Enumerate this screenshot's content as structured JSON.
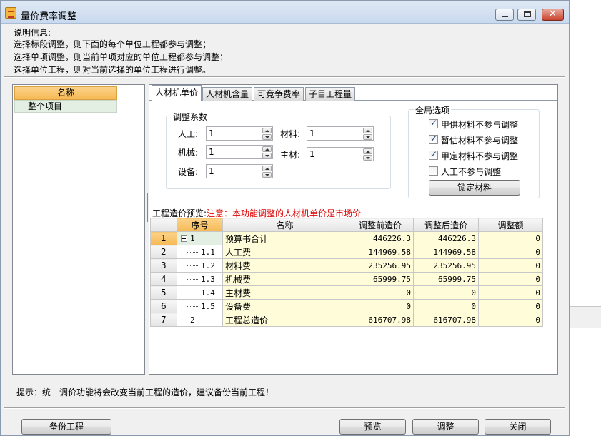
{
  "window": {
    "title": "量价费率调整"
  },
  "description": {
    "title": "说明信息:",
    "lines": [
      "选择标段调整，则下面的每个单位工程都参与调整；",
      "选择单项调整，则当前单项对应的单位工程都参与调整；",
      "选择单位工程，则对当前选择的单位工程进行调整。"
    ]
  },
  "left_tree": {
    "header": "名称",
    "items": [
      "整个项目"
    ]
  },
  "tabs": [
    "人材机单价",
    "人材机含量",
    "可竞争费率",
    "子目工程量"
  ],
  "coefficients": {
    "title": "调整系数",
    "labor_label": "人工:",
    "labor_value": "1",
    "material_label": "材料:",
    "material_value": "1",
    "machine_label": "机械:",
    "machine_value": "1",
    "main_material_label": "主材:",
    "main_material_value": "1",
    "equipment_label": "设备:",
    "equipment_value": "1"
  },
  "global_options": {
    "title": "全局选项",
    "options": [
      {
        "label": "甲供材料不参与调整",
        "checked": true
      },
      {
        "label": "暂估材料不参与调整",
        "checked": true
      },
      {
        "label": "甲定材料不参与调整",
        "checked": true
      },
      {
        "label": "人工不参与调整",
        "checked": false
      }
    ],
    "lock_button": "锁定材料"
  },
  "preview": {
    "label": "工程造价预览:",
    "warning": "注意：本功能调整的人材机单价是市场价"
  },
  "table": {
    "headers": [
      "序号",
      "名称",
      "调整前造价",
      "调整后造价",
      "调整额"
    ],
    "rows": [
      {
        "row": "1",
        "seq": "1",
        "name": "预算书合计",
        "before": "446226.3",
        "after": "446226.3",
        "diff": "0"
      },
      {
        "row": "2",
        "seq": "1.1",
        "name": "人工费",
        "before": "144969.58",
        "after": "144969.58",
        "diff": "0"
      },
      {
        "row": "3",
        "seq": "1.2",
        "name": "材料费",
        "before": "235256.95",
        "after": "235256.95",
        "diff": "0"
      },
      {
        "row": "4",
        "seq": "1.3",
        "name": "机械费",
        "before": "65999.75",
        "after": "65999.75",
        "diff": "0"
      },
      {
        "row": "5",
        "seq": "1.4",
        "name": "主材费",
        "before": "0",
        "after": "0",
        "diff": "0"
      },
      {
        "row": "6",
        "seq": "1.5",
        "name": "设备费",
        "before": "0",
        "after": "0",
        "diff": "0"
      },
      {
        "row": "7",
        "seq": "2",
        "name": "工程总造价",
        "before": "616707.98",
        "after": "616707.98",
        "diff": "0"
      }
    ]
  },
  "hint": "提示：统一调价功能将会改变当前工程的造价，建议备份当前工程！",
  "buttons": {
    "backup": "备份工程",
    "preview": "预览",
    "adjust": "调整",
    "close": "关闭"
  }
}
